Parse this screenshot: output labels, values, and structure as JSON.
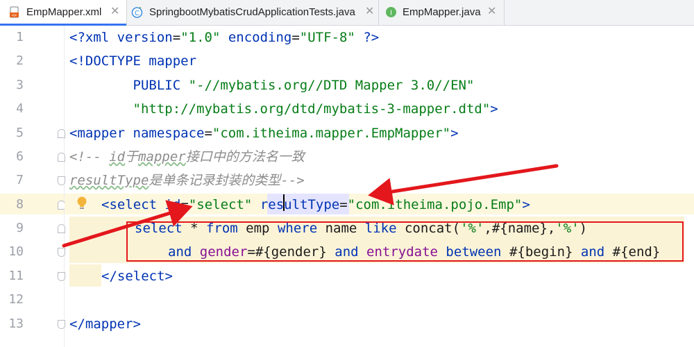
{
  "tabs": [
    {
      "label": "EmpMapper.xml",
      "icon": "xml-file-icon",
      "active": true
    },
    {
      "label": "SpringbootMybatisCrudApplicationTests.java",
      "icon": "java-class-icon",
      "active": false
    },
    {
      "label": "EmpMapper.java",
      "icon": "java-interface-icon",
      "active": false
    }
  ],
  "tab_close_glyph": "✕",
  "line_numbers": [
    "1",
    "2",
    "3",
    "4",
    "5",
    "6",
    "7",
    "8",
    "9",
    "10",
    "11",
    "12",
    "13"
  ],
  "code": {
    "l1_lt": "<?",
    "l1_xml": "xml ",
    "l1_attr1": "version",
    "l1_eq1": "=",
    "l1_val1": "\"1.0\"",
    "l1_attr2": " encoding",
    "l1_eq2": "=",
    "l1_val2": "\"UTF-8\"",
    "l1_end": " ?>",
    "l2": "<!DOCTYPE mapper",
    "l3_kw": "        PUBLIC ",
    "l3_str": "\"-//mybatis.org//DTD Mapper 3.0//EN\"",
    "l4_str": "        \"http://mybatis.org/dtd/mybatis-3-mapper.dtd\"",
    "l4_end": ">",
    "l5_open": "<mapper",
    "l5_attr": " namespace",
    "l5_eq": "=",
    "l5_val": "\"com.itheima.mapper.EmpMapper\"",
    "l5_close": ">",
    "l6_a": "<!-- ",
    "l6_b": "id",
    "l6_c": "于",
    "l6_d": "mapper",
    "l6_e": "接口中的方法名一致",
    "l7_a": "resultType",
    "l7_b": "是单条记录封装的类型-->",
    "l8_open": "<select",
    "l8_attr1": " id",
    "l8_eq1": "=",
    "l8_val1": "\"select\"",
    "l8_attr2": " resultType",
    "l8_eq2": "=",
    "l8_val2": "\"com.itheima.pojo.Emp\"",
    "l8_close": ">",
    "l9_select": "select",
    "l9_star": " * ",
    "l9_from": "from",
    "l9_emp": " emp ",
    "l9_where": "where",
    "l9_name": " name ",
    "l9_like": "like",
    "l9_concat": " concat(",
    "l9_p1": "'%'",
    "l9_mid": ",#{name},",
    "l9_p2": "'%'",
    "l9_end": ")",
    "l10_and1": "and",
    "l10_gender": " gender",
    "l10_eq": "=#{gender} ",
    "l10_and2": "and",
    "l10_entry": " entrydate ",
    "l10_between": "between",
    "l10_begin": " #{begin} ",
    "l10_and3": "and",
    "l10_end": " #{end}",
    "l11": "</select>",
    "l13_open": "</mapper",
    "l13_close": ">"
  },
  "colors": {
    "tag": "#0033b3",
    "string": "#067d17",
    "attr": "#0033b3",
    "comment": "#8c8c8c",
    "sql_column": "#871094",
    "annotation_red": "#e3171c",
    "line_highlight": "#fdf7de",
    "sql_block_bg": "#fbf3d6"
  },
  "icons": {
    "intention": "lightbulb-icon",
    "fold": "fold-marker-icon"
  }
}
